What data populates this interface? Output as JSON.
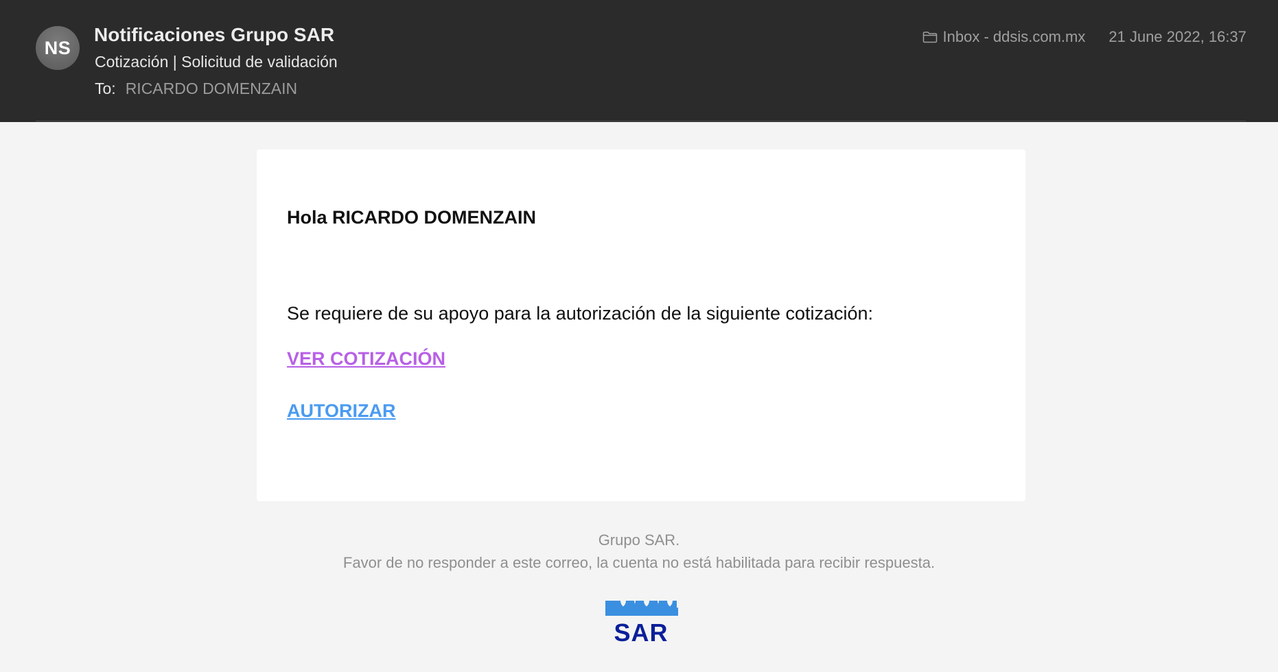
{
  "header": {
    "avatar_initials": "NS",
    "sender": "Notificaciones Grupo SAR",
    "subject": "Cotización | Solicitud de validación",
    "to_label": "To:",
    "to_value": "RICARDO DOMENZAIN",
    "folder": "Inbox - ddsis.com.mx",
    "date": "21 June 2022, 16:37",
    "folder_icon": "folder-icon"
  },
  "body": {
    "greeting": "Hola RICARDO DOMENZAIN",
    "message": "Se requiere de su apoyo para la autorización de la siguiente cotización:",
    "link_view": "VER COTIZACIÓN",
    "link_authorize": "AUTORIZAR"
  },
  "footer": {
    "company": "Grupo SAR.",
    "note": "Favor de no responder a este correo, la cuenta no está habilitada para recibir respuesta.",
    "logo_text": "SAR"
  },
  "colors": {
    "header_bg": "#2b2b2b",
    "body_bg": "#f4f4f4",
    "link_visited": "#b760e6",
    "link": "#4a9bf0",
    "logo_top": "#3b8fe0",
    "logo_text": "#0a1f9a"
  }
}
